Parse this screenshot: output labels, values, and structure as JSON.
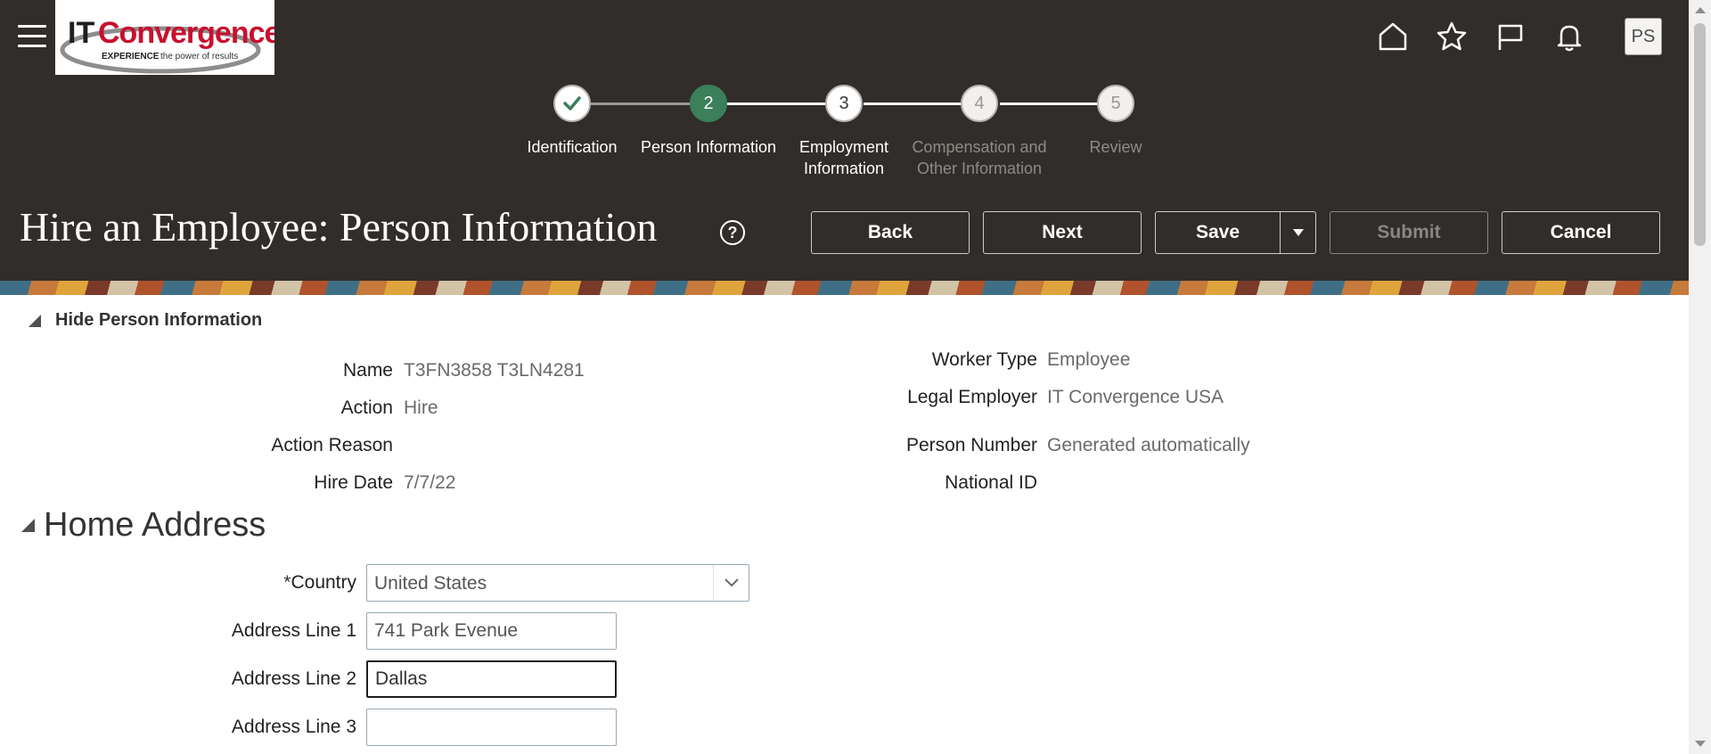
{
  "app": {
    "logo_text": "ITConvergence",
    "logo_tagline": "EXPERIENCE the power of results",
    "avatar_initials": "PS",
    "icons": [
      "home-icon",
      "star-icon",
      "flag-icon",
      "bell-icon"
    ]
  },
  "train": {
    "steps": [
      {
        "number": "",
        "label": "Identification",
        "state": "done"
      },
      {
        "number": "2",
        "label": "Person Information",
        "state": "current"
      },
      {
        "number": "3",
        "label": "Employment Information",
        "state": "next"
      },
      {
        "number": "4",
        "label": "Compensation and Other Information",
        "state": "future"
      },
      {
        "number": "5",
        "label": "Review",
        "state": "future"
      }
    ]
  },
  "page": {
    "title": "Hire an Employee: Person Information",
    "help_icon": "?"
  },
  "toolbar": {
    "back_label": "Back",
    "next_label": "Next",
    "save_label": "Save",
    "submit_label": "Submit",
    "cancel_label": "Cancel"
  },
  "person_section": {
    "toggle_label": "Hide Person Information",
    "name_label": "Name",
    "name_value": "T3FN3858 T3LN4281",
    "action_label": "Action",
    "action_value": "Hire",
    "action_reason_label": "Action Reason",
    "action_reason_value": "",
    "hire_date_label": "Hire Date",
    "hire_date_value": "7/7/22",
    "worker_type_label": "Worker Type",
    "worker_type_value": "Employee",
    "legal_employer_label": "Legal Employer",
    "legal_employer_value": "IT Convergence USA",
    "person_number_label": "Person Number",
    "person_number_value": "Generated automatically",
    "national_id_label": "National ID",
    "national_id_value": ""
  },
  "home_address": {
    "title": "Home Address",
    "country_required_marker": "*",
    "country_label": "Country",
    "country_value": "United States",
    "address1_label": "Address Line 1",
    "address1_value": "741 Park Evenue",
    "address2_label": "Address Line 2",
    "address2_value": "Dallas",
    "address3_label": "Address Line 3",
    "address3_value": ""
  },
  "colors": {
    "header_bg": "#312d2a",
    "current_step": "#3b7f5b"
  }
}
